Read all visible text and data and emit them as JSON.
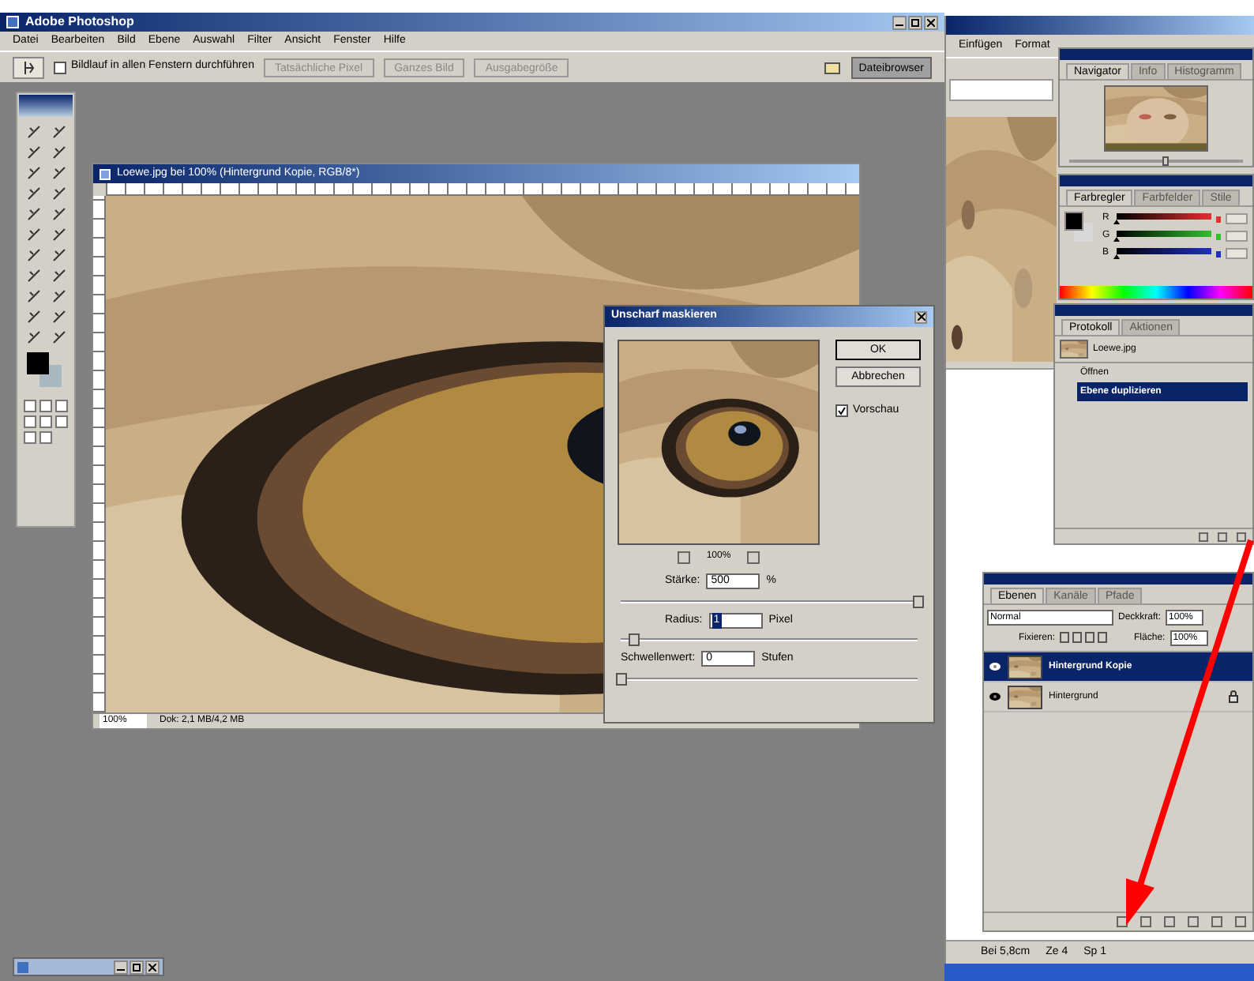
{
  "photoshop": {
    "title": "Adobe Photoshop",
    "menu": [
      "Datei",
      "Bearbeiten",
      "Bild",
      "Ebene",
      "Auswahl",
      "Filter",
      "Ansicht",
      "Fenster",
      "Hilfe"
    ],
    "options": {
      "scroll_all": {
        "label": "Bildlauf in allen Fenstern durchführen",
        "checked": false
      },
      "buttons": [
        "Tatsächliche Pixel",
        "Ganzes Bild",
        "Ausgabegröße"
      ],
      "file_browser": "Dateibrowser"
    }
  },
  "document": {
    "title": "Loewe.jpg bei 100% (Hintergrund Kopie, RGB/8*)",
    "zoom": "100%",
    "doc_info": "Dok: 2,1 MB/4,2 MB"
  },
  "dialog": {
    "title": "Unscharf maskieren",
    "buttons": [
      "OK",
      "Abbrechen"
    ],
    "preview": {
      "label": "Vorschau",
      "checked": true
    },
    "zoom": "100%",
    "params": [
      {
        "label": "Stärke:",
        "value": "500",
        "unit": "%",
        "level": 1.0,
        "selected": false
      },
      {
        "label": "Radius:",
        "value": "1",
        "unit": "Pixel",
        "level": 0.04,
        "selected": true
      },
      {
        "label": "Schwellenwert:",
        "value": "0",
        "unit": "Stufen",
        "level": 0.0,
        "selected": false
      }
    ]
  },
  "navigator": {
    "tabs": [
      {
        "label": "Navigator",
        "selected": true
      },
      {
        "label": "Info",
        "selected": false
      },
      {
        "label": "Histogramm",
        "selected": false
      }
    ],
    "zoom_level": {
      "level": 0.55
    }
  },
  "color": {
    "tabs": [
      {
        "label": "Farbregler",
        "selected": true
      },
      {
        "label": "Farbfelder",
        "selected": false
      },
      {
        "label": "Stile",
        "selected": false
      }
    ],
    "sliders": [
      {
        "label": "R",
        "color": "#e03030",
        "level": 0.0
      },
      {
        "label": "G",
        "color": "#30c030",
        "level": 0.0
      },
      {
        "label": "B",
        "color": "#2030c0",
        "level": 0.0
      }
    ]
  },
  "history": {
    "tabs": [
      {
        "label": "Protokoll",
        "selected": true
      },
      {
        "label": "Aktionen",
        "selected": false
      }
    ],
    "snapshot": "Loewe.jpg",
    "steps": [
      {
        "label": "Öffnen",
        "selected": false
      },
      {
        "label": "Ebene duplizieren",
        "selected": true
      }
    ]
  },
  "layers": {
    "tabs": [
      {
        "label": "Ebenen",
        "selected": true
      },
      {
        "label": "Kanäle",
        "selected": false
      },
      {
        "label": "Pfade",
        "selected": false
      }
    ],
    "blend_mode": "Normal",
    "opacity_label": "Deckkraft:",
    "opacity": "100%",
    "lock_label": "Fixieren:",
    "fill_label": "Fläche:",
    "fill": "100%",
    "items": [
      {
        "name": "Hintergrund Kopie",
        "selected": true,
        "locked": false
      },
      {
        "name": "Hintergrund",
        "selected": false,
        "locked": true
      }
    ]
  },
  "word": {
    "menu": [
      "Einfügen",
      "Format"
    ],
    "status": [
      "Bei 5,8cm",
      "Ze 4",
      "Sp 1"
    ]
  }
}
